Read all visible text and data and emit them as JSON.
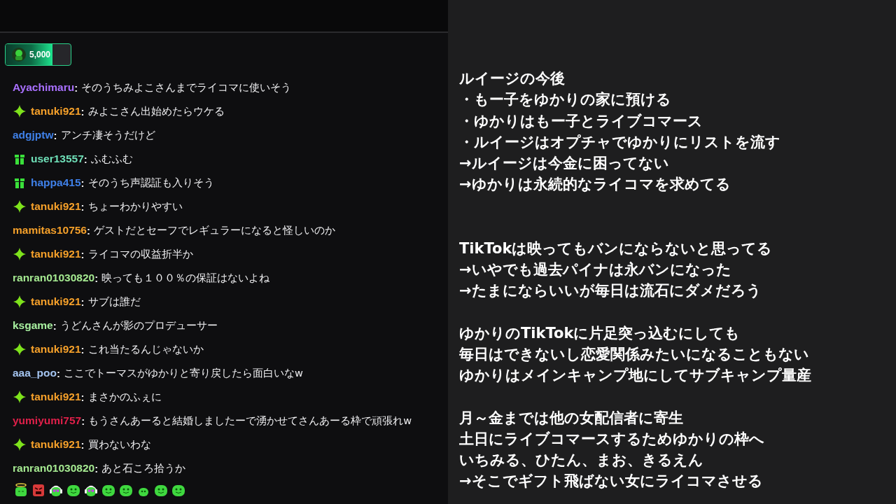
{
  "points": {
    "value": "5,000",
    "level": 0.72
  },
  "chat": [
    {
      "kind": "plain",
      "user": "Ayachimaru",
      "color": "#a970ff",
      "sep": ":",
      "text": "そのうちみよこさんまでライコマに使いそう"
    },
    {
      "kind": "star",
      "user": "tanuki921",
      "color": "#f5a02a",
      "sep": ":",
      "text": "みよこさん出始めたらウケる"
    },
    {
      "kind": "plain",
      "user": "adgjptw",
      "color": "#3f80e8",
      "sep": ":",
      "text": "アンチ凄そうだけど"
    },
    {
      "kind": "gift",
      "user": "user13557",
      "color": "#6fe0b8",
      "sep": ":",
      "text": "ふむふむ"
    },
    {
      "kind": "gift",
      "user": "happa415",
      "color": "#3f80e8",
      "sep": ":",
      "text": "そのうち声認証も入りそう"
    },
    {
      "kind": "star",
      "user": "tanuki921",
      "color": "#f5a02a",
      "sep": ":",
      "text": "ちょーわかりやすい"
    },
    {
      "kind": "plain",
      "user": "mamitas10756",
      "color": "#f5a02a",
      "sep": ":",
      "text": "ゲストだとセーフでレギュラーになると怪しいのか"
    },
    {
      "kind": "star",
      "user": "tanuki921",
      "color": "#f5a02a",
      "sep": ":",
      "text": "ライコマの収益折半か"
    },
    {
      "kind": "plain",
      "user": "ranran01030820",
      "color": "#a4e890",
      "sep": ":",
      "text": "映っても１００％の保証はないよね"
    },
    {
      "kind": "star",
      "user": "tanuki921",
      "color": "#f5a02a",
      "sep": ":",
      "text": "サブは誰だ"
    },
    {
      "kind": "plain",
      "user": "ksgame",
      "color": "#a8f0a0",
      "sep": ":",
      "text": "うどんさんが影のプロデューサー"
    },
    {
      "kind": "star",
      "user": "tanuki921",
      "color": "#f5a02a",
      "sep": ":",
      "text": "これ当たるんじゃないか"
    },
    {
      "kind": "plain",
      "user": "aaa_poo",
      "color": "#a4c4f0",
      "sep": ":",
      "text": "ここでトーマスがゆかりと寄り戻したら面白いなw"
    },
    {
      "kind": "star",
      "user": "tanuki921",
      "color": "#f5a02a",
      "sep": ":",
      "text": "まさかのふぇに"
    },
    {
      "kind": "plain",
      "user": "yumiyumi757",
      "color": "#e0204a",
      "sep": ":",
      "text": "もうさんあーると結婚しましたーで湧かせてさんあーる枠で頑張れw"
    },
    {
      "kind": "star",
      "user": "tanuki921",
      "color": "#f5a02a",
      "sep": ":",
      "text": "買わないわな"
    },
    {
      "kind": "plain",
      "user": "ranran01030820",
      "color": "#a4e890",
      "sep": ":",
      "text": "あと石ころ拾うか"
    }
  ],
  "emotes": [
    {
      "kind": "halo"
    },
    {
      "kind": "angry"
    },
    {
      "kind": "headphones"
    },
    {
      "kind": "blob"
    },
    {
      "kind": "headphones"
    },
    {
      "kind": "blob"
    },
    {
      "kind": "blob"
    },
    {
      "kind": "small"
    },
    {
      "kind": "blob"
    },
    {
      "kind": "blob"
    }
  ],
  "notes": [
    [
      "ルイージの今後",
      "・もー子をゆかりの家に預ける",
      "・ゆかりはもー子とライブコマース",
      "・ルイージはオプチャでゆかりにリストを流す",
      "→ルイージは今金に困ってない",
      "→ゆかりは永続的なライコマを求めてる"
    ],
    [
      "TikTokは映ってもバンにならないと思ってる",
      "→いやでも過去パイナは永バンになった",
      "→たまにならいいが毎日は流石にダメだろう"
    ],
    [
      "ゆかりのTikTokに片足突っ込むにしても",
      "毎日はできないし恋愛関係みたいになることもない",
      "ゆかりはメインキャンプ地にしてサブキャンプ量産"
    ],
    [
      "月～金までは他の女配信者に寄生",
      "土日にライブコマースするためゆかりの枠へ",
      "いちみる、ひたん、まお、きるえん",
      "→そこでギフト飛ばない女にライコマさせる"
    ]
  ]
}
